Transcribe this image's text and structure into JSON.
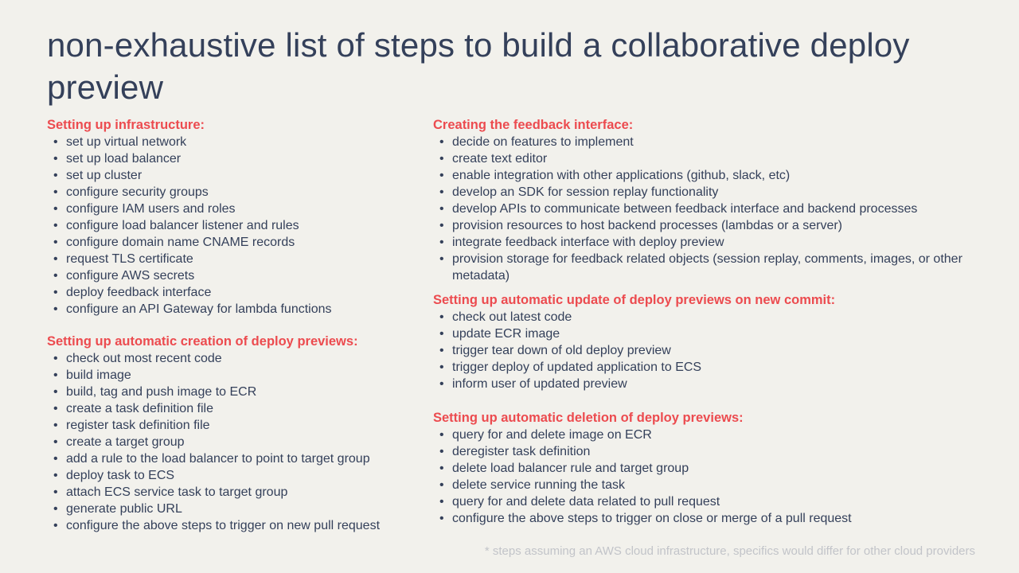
{
  "title": "non-exhaustive list of steps to build a collaborative deploy preview",
  "left_column": {
    "sections": [
      {
        "heading": "Setting up infrastructure:",
        "items": [
          "set up virtual network",
          "set up load balancer",
          "set up cluster",
          "configure security groups",
          "configure IAM users and roles",
          "configure load balancer listener and rules",
          "configure domain name CNAME records",
          "request TLS certificate",
          "configure AWS secrets",
          "deploy feedback interface",
          "configure an API Gateway for lambda functions"
        ]
      },
      {
        "heading": "Setting up automatic creation of deploy previews:",
        "items": [
          "check out most recent code",
          "build image",
          "build, tag and push image to ECR",
          "create a task definition file",
          "register task definition file",
          "create a target group",
          "add a rule to the load balancer to point to target group",
          "deploy task to ECS",
          "attach ECS service task to target group",
          "generate public URL",
          "configure the above steps to trigger on new pull request"
        ]
      }
    ]
  },
  "right_column": {
    "sections": [
      {
        "heading": "Creating the feedback interface:",
        "items": [
          "decide on features to implement",
          "create text editor",
          "enable integration with other applications (github, slack, etc)",
          "develop an SDK for session replay functionality",
          "develop APIs to communicate between feedback interface and backend processes",
          "provision resources to host backend processes (lambdas or a server)",
          "integrate feedback interface with deploy preview",
          "provision storage for feedback related objects (session replay, comments, images, or other metadata)"
        ]
      },
      {
        "heading": "Setting up automatic update of deploy previews on new commit:",
        "items": [
          "check out latest code",
          "update ECR image",
          "trigger tear down of old deploy preview",
          "trigger deploy of updated application to ECS",
          "inform user of updated preview"
        ]
      },
      {
        "heading": "Setting up automatic deletion of deploy previews:",
        "items": [
          "query for and delete image on ECR",
          "deregister task definition",
          "delete load balancer rule and target group",
          "delete service running the task",
          "query for and delete data related to pull request",
          "configure the above steps to trigger on close or merge of a pull request"
        ]
      }
    ]
  },
  "footnote": "* steps assuming an AWS cloud infrastructure, specifics would differ for other cloud providers",
  "colors": {
    "background": "#f2f1ec",
    "text": "#34405a",
    "heading": "#ec4b4f",
    "footnote": "#c2c4c9"
  }
}
